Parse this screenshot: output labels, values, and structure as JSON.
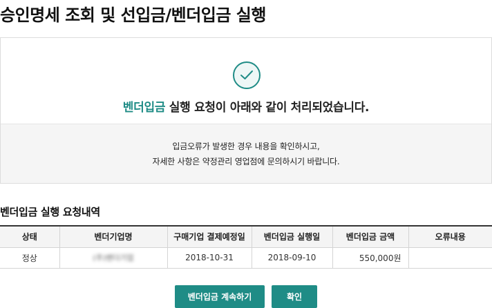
{
  "page": {
    "title": "승인명세 조회 및 선입금/벤더입금 실행"
  },
  "result": {
    "accent_text": "벤더입금",
    "message_rest": " 실행 요청이 아래와 같이 처리되었습니다.",
    "notice_line1": "입금오류가 발생한 경우 내용을 확인하시고,",
    "notice_line2": "자세한 사항은 약정관리 영업점에 문의하시기 바랍니다.",
    "icon": "check-circle-icon",
    "accent_color": "#1f8c86"
  },
  "section": {
    "title": "벤더입금 실행 요청내역"
  },
  "table": {
    "headers": [
      "상태",
      "벤더기업명",
      "구매기업 결제예정일",
      "벤더입금 실행일",
      "벤더입금 금액",
      "오류내용"
    ],
    "rows": [
      {
        "status": "정상",
        "vendor": "(주)밴더기업",
        "due_date": "2018-10-31",
        "exec_date": "2018-09-10",
        "amount": "550,000원",
        "error": ""
      }
    ]
  },
  "buttons": {
    "continue_label": "벤더입금 계속하기",
    "confirm_label": "확인"
  }
}
